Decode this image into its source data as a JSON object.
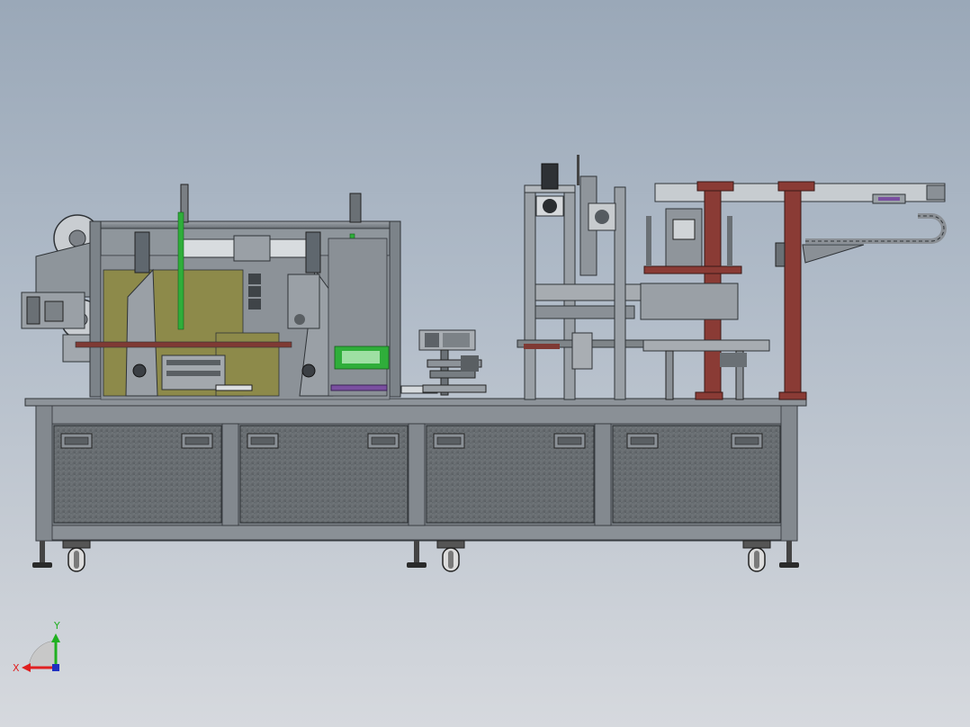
{
  "viewport": {
    "background_top": "#9aa8b8",
    "background_bottom": "#d6d9de"
  },
  "colors": {
    "frame_steel": "#7e858c",
    "frame_dark": "#4a4f55",
    "panel_dark": "#5c6064",
    "red_column": "#8a3b35",
    "olive_plate": "#8d8a4a",
    "green_rod": "#2fae3a",
    "purple_part": "#7a4fa0"
  },
  "triad": {
    "x_label": "X",
    "y_label": "Y",
    "x_color": "#e02020",
    "y_color": "#20b020",
    "z_color": "#2030c0"
  },
  "cabinet": {
    "door_count": 4,
    "caster_count": 3
  }
}
